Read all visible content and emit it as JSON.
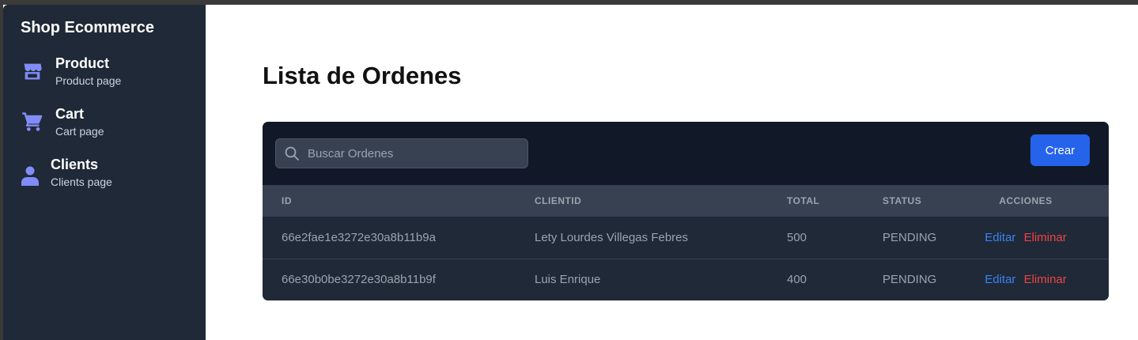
{
  "sidebar": {
    "brand": "Shop Ecommerce",
    "items": [
      {
        "title": "Product",
        "subtitle": "Product page",
        "icon": "store-icon"
      },
      {
        "title": "Cart",
        "subtitle": "Cart page",
        "icon": "cart-icon"
      },
      {
        "title": "Clients",
        "subtitle": "Clients page",
        "icon": "user-icon"
      }
    ]
  },
  "main": {
    "title": "Lista de Ordenes",
    "search": {
      "placeholder": "Buscar Ordenes",
      "value": ""
    },
    "create_label": "Crear",
    "table": {
      "headers": [
        "ID",
        "CLIENTID",
        "TOTAL",
        "STATUS",
        "ACCIONES"
      ],
      "rows": [
        {
          "id": "66e2fae1e3272e30a8b11b9a",
          "client": "Lety Lourdes Villegas Febres",
          "total": "500",
          "status": "PENDING",
          "edit": "Editar",
          "delete": "Eliminar"
        },
        {
          "id": "66e30b0be3272e30a8b11b9f",
          "client": "Luis Enrique",
          "total": "400",
          "status": "PENDING",
          "edit": "Editar",
          "delete": "Eliminar"
        }
      ]
    }
  },
  "colors": {
    "sidebar_bg": "#1f2937",
    "icon_accent": "#818cf8",
    "primary_button": "#2563eb",
    "edit_link": "#3b82f6",
    "delete_link": "#ef4444"
  }
}
